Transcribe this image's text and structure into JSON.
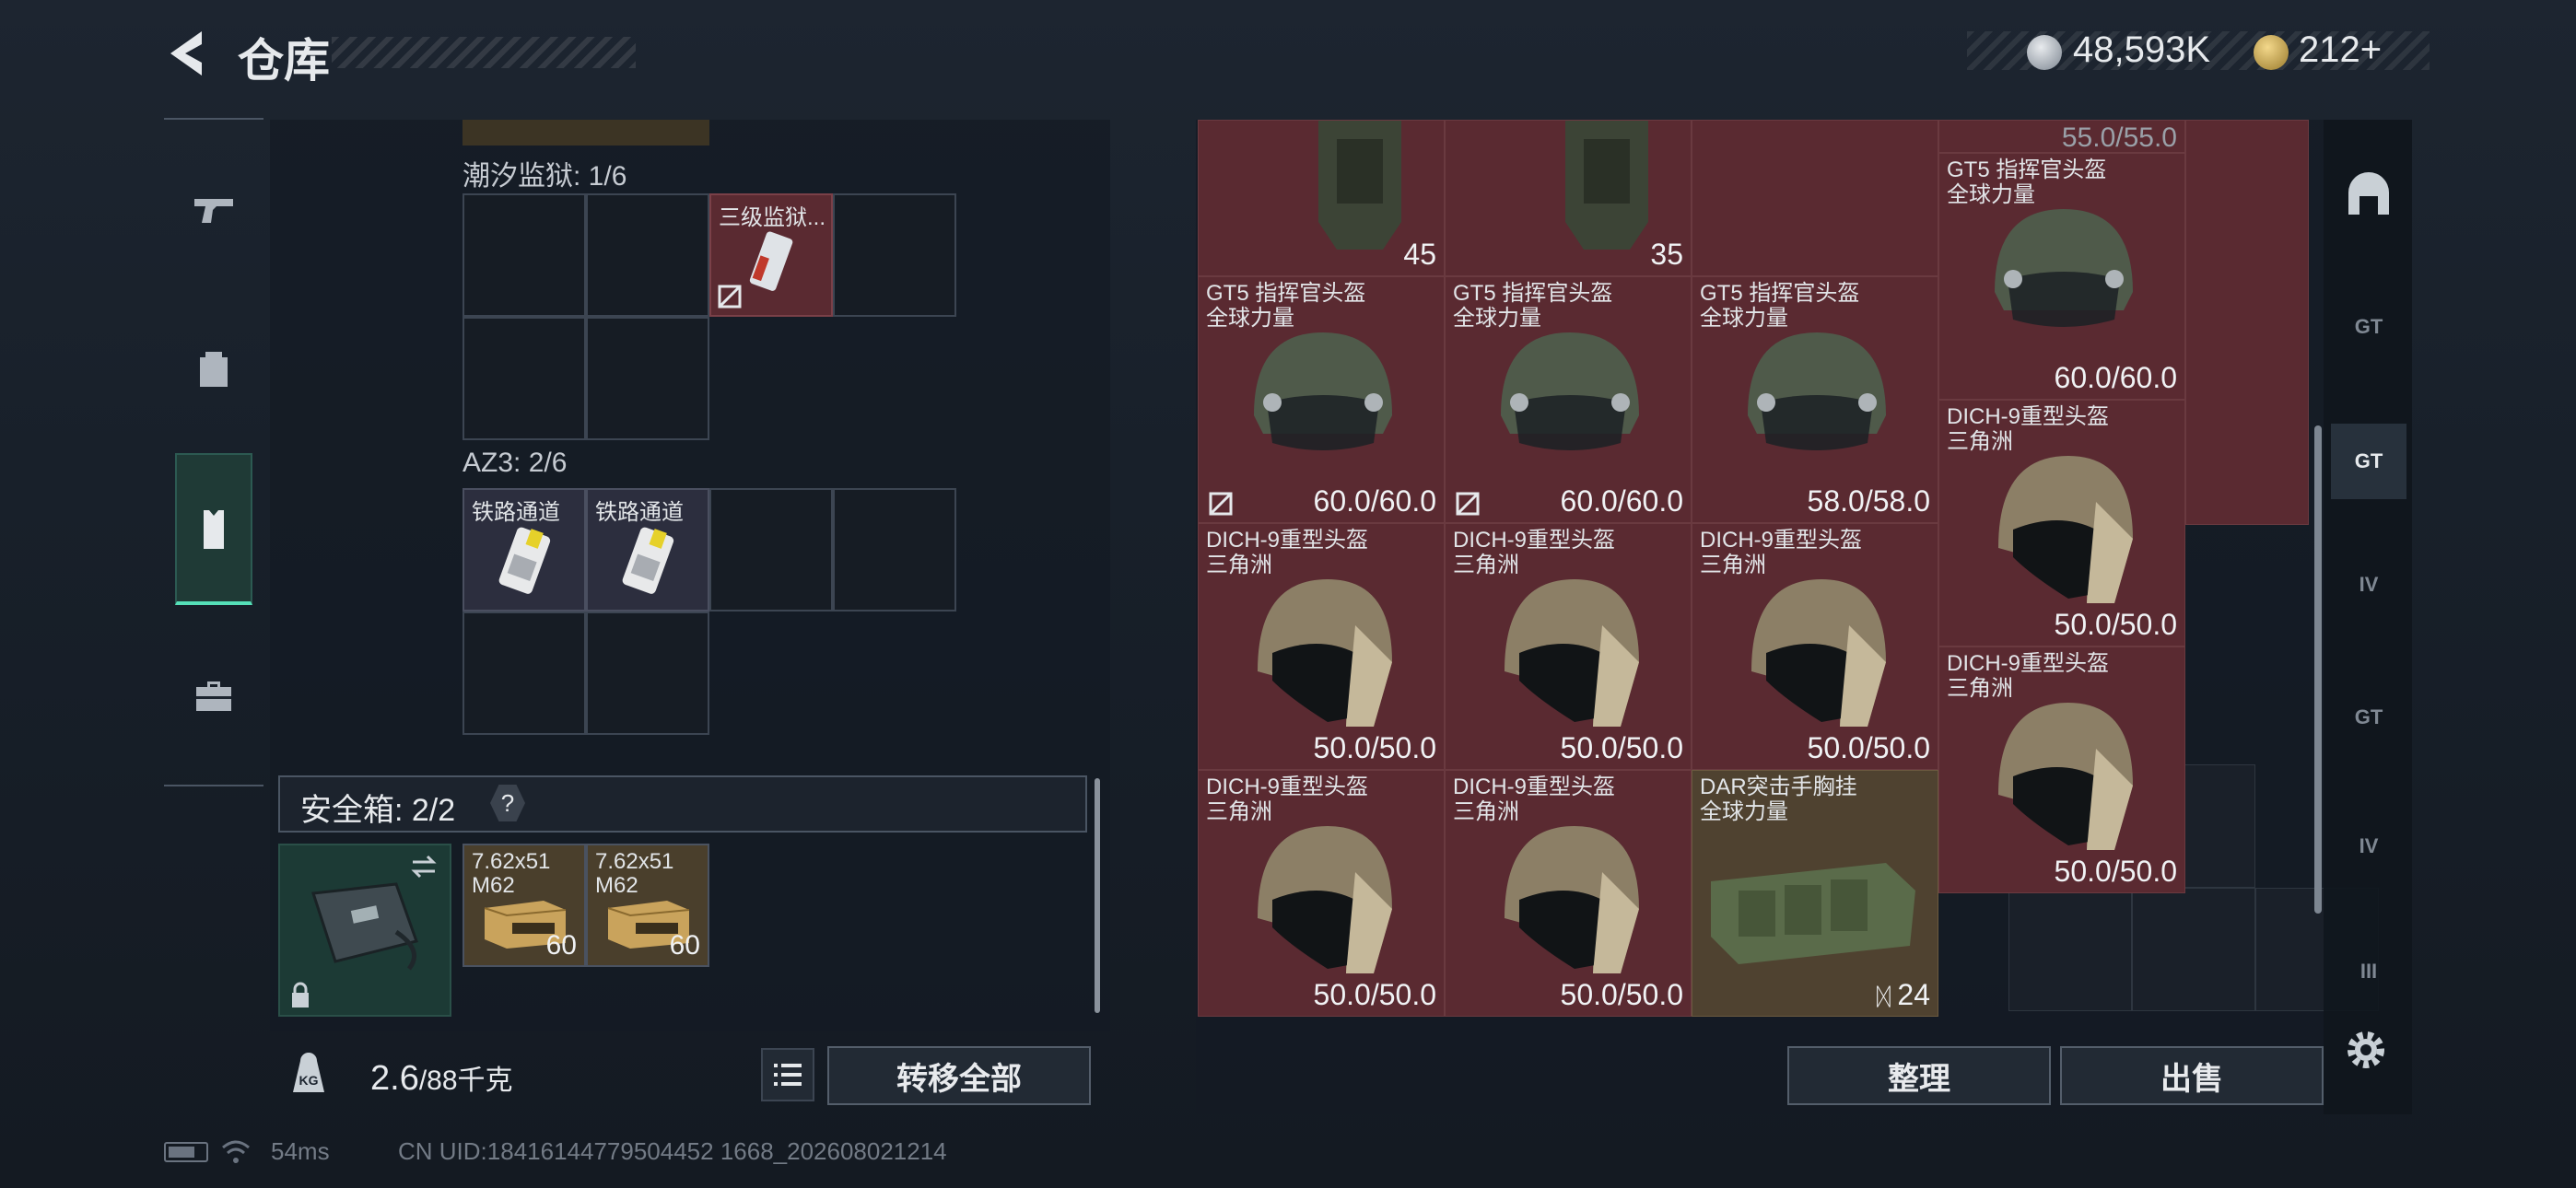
{
  "header": {
    "title": "仓库"
  },
  "currency": {
    "silver": "48,593K",
    "gold": "212",
    "gold_add": "+"
  },
  "rail": {
    "items": [
      "pistol-icon",
      "backpack-icon",
      "chest-rig-icon",
      "toolbox-icon"
    ],
    "selected": 2
  },
  "left": {
    "sections": [
      {
        "label": "潮汐监狱: 1/6",
        "items": [
          {
            "name": "三级监狱..."
          }
        ]
      },
      {
        "label": "AZ3: 2/6",
        "items": [
          {
            "name": "铁路通道"
          },
          {
            "name": "铁路通道"
          }
        ]
      }
    ],
    "safe_box": {
      "label": "安全箱: 2/2",
      "help": "?"
    },
    "ammo": [
      {
        "name": "7.62x51",
        "sub": "M62",
        "count": "60"
      },
      {
        "name": "7.62x51",
        "sub": "M62",
        "count": "60"
      }
    ],
    "weight": {
      "current": "2.6",
      "max": "/88千克"
    },
    "transfer_label": "转移全部"
  },
  "right": {
    "items": [
      {
        "name": "",
        "sub": "",
        "value": "45"
      },
      {
        "name": "",
        "sub": "",
        "value": "35"
      },
      {
        "name": "",
        "sub": "",
        "value": "55.0/55.0"
      },
      {
        "name": "GT5 指挥官头盔",
        "sub": "全球力量",
        "value": "60.0/60.0"
      },
      {
        "name": "GT5 指挥官头盔",
        "sub": "全球力量",
        "value": "60.0/60.0"
      },
      {
        "name": "GT5 指挥官头盔",
        "sub": "全球力量",
        "value": "60.0/60.0"
      },
      {
        "name": "GT5 指挥官头盔",
        "sub": "全球力量",
        "value": "58.0/58.0"
      },
      {
        "name": "DICH-9重型头盔",
        "sub": "三角洲",
        "value": "50.0/50.0"
      },
      {
        "name": "DICH-9重型头盔",
        "sub": "三角洲",
        "value": "50.0/50.0"
      },
      {
        "name": "DICH-9重型头盔",
        "sub": "三角洲",
        "value": "50.0/50.0"
      },
      {
        "name": "DICH-9重型头盔",
        "sub": "三角洲",
        "value": "50.0/50.0"
      },
      {
        "name": "DICH-9重型头盔",
        "sub": "三角洲",
        "value": "50.0/50.0"
      },
      {
        "name": "DICH-9重型头盔",
        "sub": "三角洲",
        "value": "50.0/50.0"
      },
      {
        "name": "DICH-9重型头盔",
        "sub": "三角洲",
        "value": "50.0/50.0"
      },
      {
        "name": "DAR突击手胸挂",
        "sub": "全球力量",
        "value": "24"
      }
    ],
    "sort_label": "整理",
    "sell_label": "出售",
    "filters": [
      "GT",
      "GT",
      "IV",
      "GT",
      "IV",
      "III"
    ]
  },
  "status": {
    "ping": "54ms",
    "uid": "CN UID:18416144779504452 1668_202608021214"
  }
}
